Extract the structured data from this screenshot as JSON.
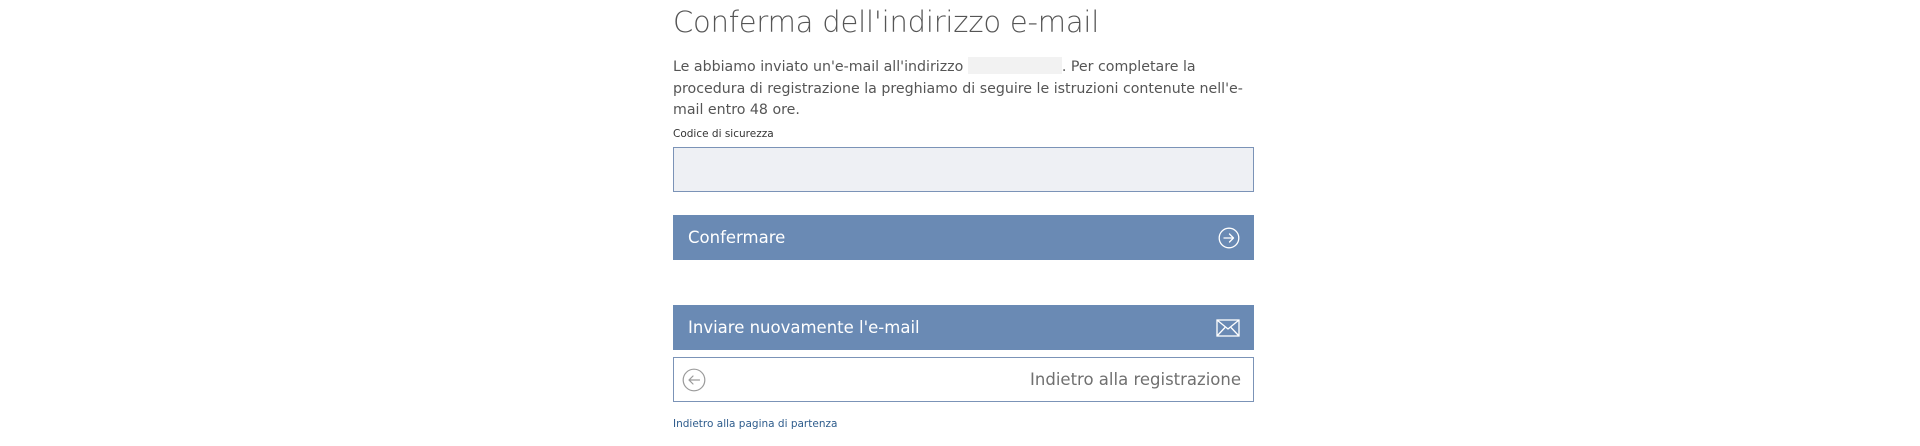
{
  "page": {
    "title": "Conferma dell'indirizzo e-mail"
  },
  "intro": {
    "text_before": "Le abbiamo inviato un'e-mail all'indirizzo ",
    "text_after": ". Per completare la procedura di registrazione la preghiamo di seguire le istruzioni contenute nell'e-mail entro 48 ore."
  },
  "security_code": {
    "label": "Codice di sicurezza",
    "value": "",
    "placeholder": ""
  },
  "buttons": {
    "confirm": {
      "label": "Confermare",
      "icon": "arrow-right-circle-icon"
    },
    "resend": {
      "label": "Inviare nuovamente l'e-mail",
      "icon": "envelope-icon"
    },
    "back": {
      "label": "Indietro alla registrazione",
      "icon": "arrow-left-circle-icon"
    }
  },
  "links": {
    "home": "Indietro alla pagina di partenza"
  },
  "colors": {
    "primary_button": "#6a8ab4",
    "input_background": "#eef0f4",
    "border": "#7b93b7"
  }
}
